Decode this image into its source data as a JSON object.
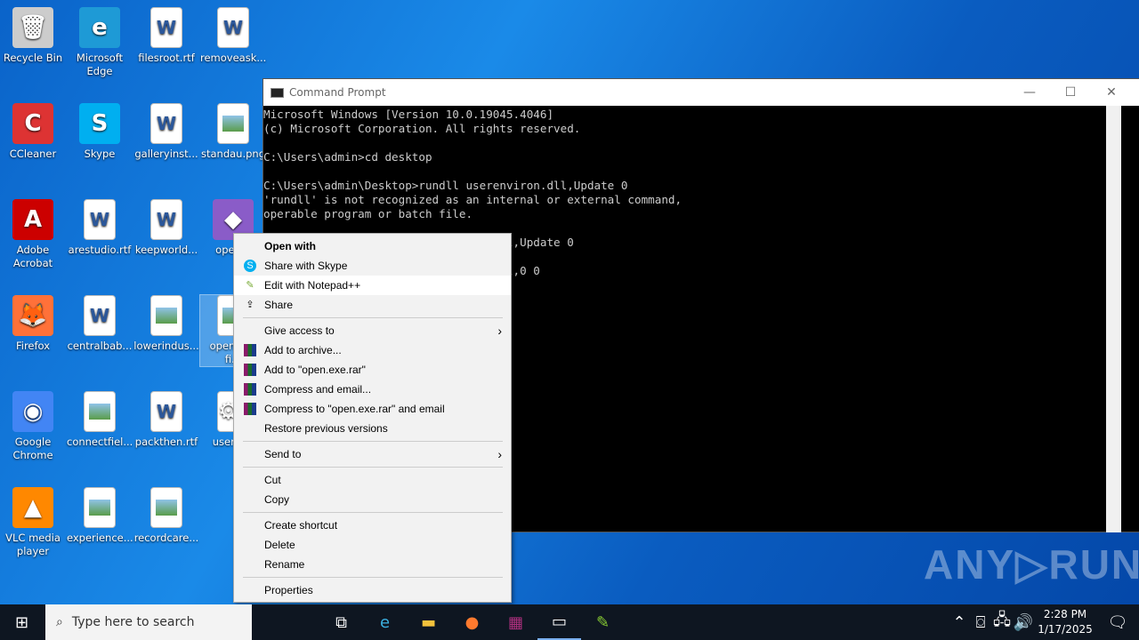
{
  "desktop": {
    "icons": [
      {
        "label": "Recycle Bin",
        "glyph": "🗑",
        "kind": "app"
      },
      {
        "label": "Microsoft Edge",
        "glyph": "e",
        "kind": "app"
      },
      {
        "label": "filesroot.rtf",
        "glyph": "W",
        "kind": "doc"
      },
      {
        "label": "removeask...",
        "glyph": "W",
        "kind": "doc"
      },
      {
        "label": "CCleaner",
        "glyph": "C",
        "kind": "app"
      },
      {
        "label": "Skype",
        "glyph": "S",
        "kind": "app"
      },
      {
        "label": "galleryinst...",
        "glyph": "W",
        "kind": "doc"
      },
      {
        "label": "standau.png",
        "glyph": "",
        "kind": "img"
      },
      {
        "label": "Adobe Acrobat",
        "glyph": "A",
        "kind": "app"
      },
      {
        "label": "arestudio.rtf",
        "glyph": "W",
        "kind": "doc"
      },
      {
        "label": "keepworld...",
        "glyph": "W",
        "kind": "doc"
      },
      {
        "label": "open...",
        "glyph": "◆",
        "kind": "app"
      },
      {
        "label": "Firefox",
        "glyph": "🦊",
        "kind": "app"
      },
      {
        "label": "centralbab...",
        "glyph": "W",
        "kind": "doc"
      },
      {
        "label": "lowerindus...",
        "glyph": "",
        "kind": "img"
      },
      {
        "label": "open.exe fi...",
        "glyph": "",
        "kind": "file"
      },
      {
        "label": "Google Chrome",
        "glyph": "◉",
        "kind": "app"
      },
      {
        "label": "connectfiel...",
        "glyph": "",
        "kind": "img"
      },
      {
        "label": "packthen.rtf",
        "glyph": "W",
        "kind": "doc"
      },
      {
        "label": "userer...",
        "glyph": "⚙",
        "kind": "file"
      },
      {
        "label": "VLC media player",
        "glyph": "▲",
        "kind": "app"
      },
      {
        "label": "experience...",
        "glyph": "",
        "kind": "img"
      },
      {
        "label": "recordcare...",
        "glyph": "",
        "kind": "img"
      }
    ]
  },
  "cmd": {
    "title": "Command Prompt",
    "lines": [
      "Microsoft Windows [Version 10.0.19045.4046]",
      "(c) Microsoft Corporation. All rights reserved.",
      "",
      "C:\\Users\\admin>cd desktop",
      "",
      "C:\\Users\\admin\\Desktop>rundll userenviron.dll,Update 0",
      "'rundll' is not recognized as an internal or external command,",
      "operable program or batch file.",
      "",
      "                         renviron.dll,Update 0",
      "",
      "                         renviron.dll,0 0"
    ]
  },
  "context_menu": {
    "items": [
      {
        "label": "Open with",
        "bold": true
      },
      {
        "label": "Share with Skype",
        "icon": "skype-icon"
      },
      {
        "label": "Edit with Notepad++",
        "icon": "notepadpp-icon",
        "highlight": true
      },
      {
        "label": "Share",
        "icon": "share-icon"
      },
      {
        "sep": true
      },
      {
        "label": "Give access to",
        "submenu": true
      },
      {
        "label": "Add to archive...",
        "icon": "winrar-icon"
      },
      {
        "label": "Add to \"open.exe.rar\"",
        "icon": "winrar-icon"
      },
      {
        "label": "Compress and email...",
        "icon": "winrar-icon"
      },
      {
        "label": "Compress to \"open.exe.rar\" and email",
        "icon": "winrar-icon"
      },
      {
        "label": "Restore previous versions"
      },
      {
        "sep": true
      },
      {
        "label": "Send to",
        "submenu": true
      },
      {
        "sep": true
      },
      {
        "label": "Cut"
      },
      {
        "label": "Copy"
      },
      {
        "sep": true
      },
      {
        "label": "Create shortcut"
      },
      {
        "label": "Delete"
      },
      {
        "label": "Rename"
      },
      {
        "sep": true
      },
      {
        "label": "Properties"
      }
    ]
  },
  "taskbar": {
    "search_placeholder": "Type here to search",
    "time": "2:28 PM",
    "date": "1/17/2025"
  },
  "watermark": "ANY▷RUN"
}
